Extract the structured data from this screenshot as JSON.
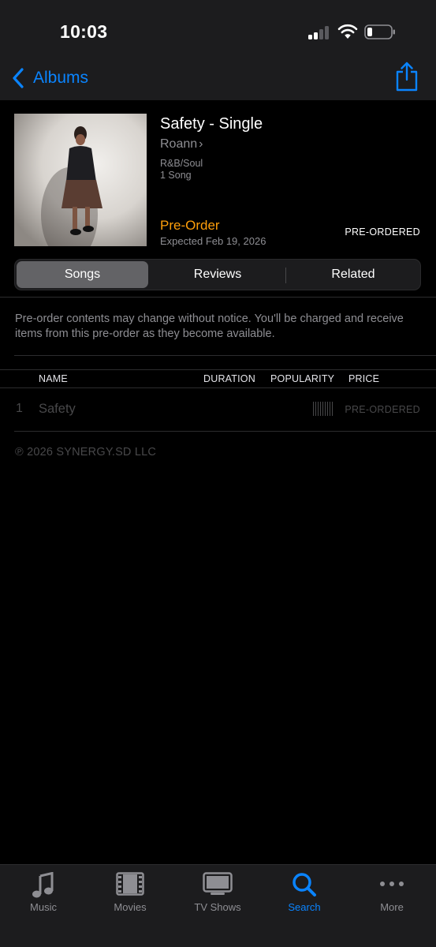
{
  "status_bar": {
    "time": "10:03"
  },
  "nav": {
    "back_label": "Albums",
    "back_icon": "chevron-left-icon",
    "share_icon": "share-icon"
  },
  "album": {
    "title": "Safety - Single",
    "artist": "Roann",
    "genre": "R&B/Soul",
    "song_count": "1 Song",
    "preorder_label": "Pre-Order",
    "expected": "Expected Feb 19, 2026",
    "status": "PRE-ORDERED"
  },
  "segments": [
    {
      "label": "Songs",
      "active": true
    },
    {
      "label": "Reviews",
      "active": false
    },
    {
      "label": "Related",
      "active": false
    }
  ],
  "notice": "Pre-order contents may change without notice. You'll be charged and receive items from this pre-order as they become available.",
  "table": {
    "headers": {
      "name": "NAME",
      "duration": "DURATION",
      "popularity": "POPULARITY",
      "price": "PRICE"
    },
    "rows": [
      {
        "number": "1",
        "name": "Safety",
        "price": "PRE-ORDERED"
      }
    ]
  },
  "copyright": "℗ 2026 SYNERGY.SD LLC",
  "tab_bar": [
    {
      "label": "Music",
      "icon": "music-note-icon",
      "active": false
    },
    {
      "label": "Movies",
      "icon": "film-icon",
      "active": false
    },
    {
      "label": "TV Shows",
      "icon": "tv-icon",
      "active": false
    },
    {
      "label": "Search",
      "icon": "search-icon",
      "active": true
    },
    {
      "label": "More",
      "icon": "more-icon",
      "active": false
    }
  ],
  "colors": {
    "accent": "#0a84ff",
    "preorder": "#ff9f0a",
    "background": "#000000",
    "bar": "#1c1c1e"
  }
}
